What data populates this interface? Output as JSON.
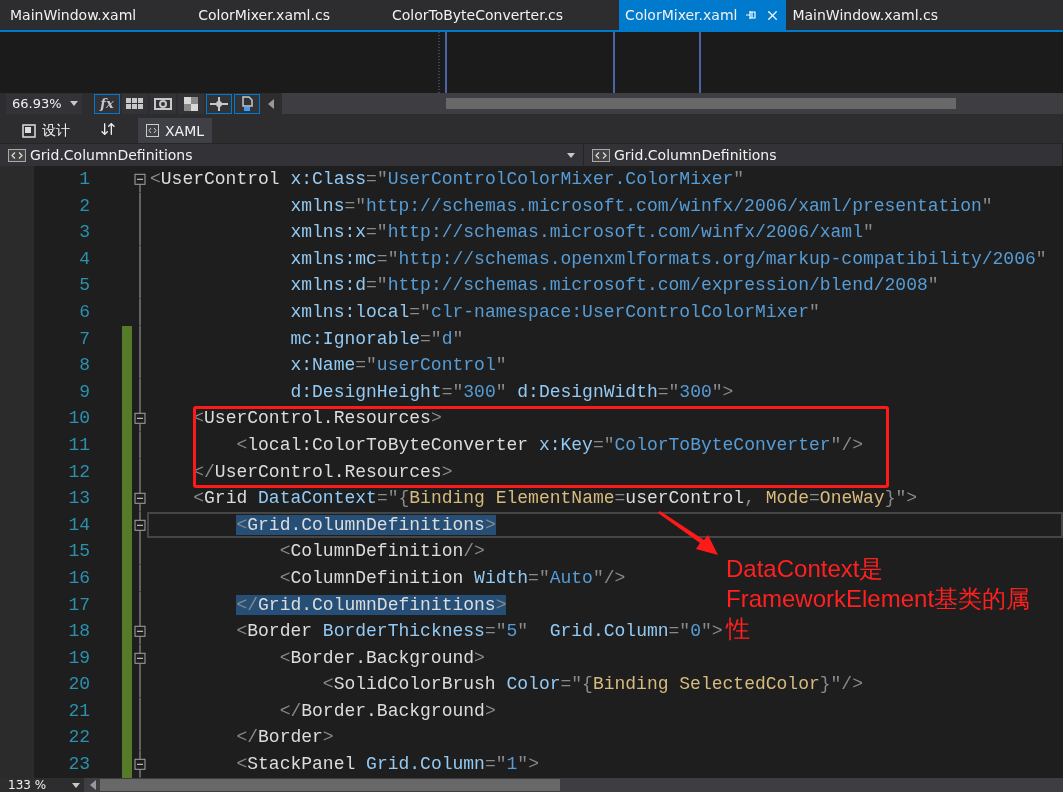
{
  "tabs": [
    {
      "label": "MainWindow.xaml",
      "selected": false
    },
    {
      "label": "ColorMixer.xaml.cs",
      "selected": false
    },
    {
      "label": "ColorToByteConverter.cs",
      "selected": false
    },
    {
      "label": "ColorMixer.xaml",
      "selected": true
    },
    {
      "label": "MainWindow.xaml.cs",
      "selected": false
    }
  ],
  "design_toolbar": {
    "zoom": "66.93%",
    "tools": [
      {
        "kind": "fx",
        "label": "fx",
        "on": true
      },
      {
        "kind": "grid",
        "on": false
      },
      {
        "kind": "snap",
        "on": false
      },
      {
        "kind": "checker",
        "on": false
      },
      {
        "kind": "crosshair",
        "on": true
      },
      {
        "kind": "refresh",
        "on": true
      }
    ]
  },
  "view_tabs": [
    {
      "kind": "design",
      "label": "设计",
      "selected": false
    },
    {
      "kind": "xaml",
      "label": "XAML",
      "selected": true
    }
  ],
  "nav_bar": {
    "left": "Grid.ColumnDefinitions",
    "right": "Grid.ColumnDefinitions"
  },
  "editor": {
    "zoom": "133 %",
    "lines": [
      {
        "number": "1",
        "modified": false,
        "collapsible": true,
        "current": false,
        "matched": false,
        "segments": [
          {
            "kind": "punct",
            "text": "<"
          },
          {
            "kind": "element",
            "text": "UserControl"
          },
          {
            "kind": "attribute",
            "text": " x:Class"
          },
          {
            "kind": "punct",
            "text": "=\""
          },
          {
            "kind": "value",
            "text": "UserControlColorMixer.ColorMixer"
          },
          {
            "kind": "punct",
            "text": "\""
          }
        ]
      },
      {
        "number": "2",
        "modified": false,
        "collapsible": false,
        "current": false,
        "matched": false,
        "segments": [
          {
            "kind": "attribute",
            "text": "             xmlns"
          },
          {
            "kind": "punct",
            "text": "=\""
          },
          {
            "kind": "value",
            "text": "http://schemas.microsoft.com/winfx/2006/xaml/presentation"
          },
          {
            "kind": "punct",
            "text": "\""
          }
        ]
      },
      {
        "number": "3",
        "modified": false,
        "collapsible": false,
        "current": false,
        "matched": false,
        "segments": [
          {
            "kind": "attribute",
            "text": "             xmlns:x"
          },
          {
            "kind": "punct",
            "text": "=\""
          },
          {
            "kind": "value",
            "text": "http://schemas.microsoft.com/winfx/2006/xaml"
          },
          {
            "kind": "punct",
            "text": "\""
          }
        ]
      },
      {
        "number": "4",
        "modified": false,
        "collapsible": false,
        "current": false,
        "matched": false,
        "segments": [
          {
            "kind": "attribute",
            "text": "             xmlns:mc"
          },
          {
            "kind": "punct",
            "text": "=\""
          },
          {
            "kind": "value",
            "text": "http://schemas.openxmlformats.org/markup-compatibility/2006"
          },
          {
            "kind": "punct",
            "text": "\""
          }
        ]
      },
      {
        "number": "5",
        "modified": false,
        "collapsible": false,
        "current": false,
        "matched": false,
        "segments": [
          {
            "kind": "attribute",
            "text": "             xmlns:d"
          },
          {
            "kind": "punct",
            "text": "=\""
          },
          {
            "kind": "value",
            "text": "http://schemas.microsoft.com/expression/blend/2008"
          },
          {
            "kind": "punct",
            "text": "\""
          }
        ]
      },
      {
        "number": "6",
        "modified": false,
        "collapsible": false,
        "current": false,
        "matched": false,
        "segments": [
          {
            "kind": "attribute",
            "text": "             xmlns:local"
          },
          {
            "kind": "punct",
            "text": "=\""
          },
          {
            "kind": "value",
            "text": "clr-namespace:UserControlColorMixer"
          },
          {
            "kind": "punct",
            "text": "\""
          }
        ]
      },
      {
        "number": "7",
        "modified": true,
        "collapsible": false,
        "current": false,
        "matched": false,
        "segments": [
          {
            "kind": "attribute",
            "text": "             mc:Ignorable"
          },
          {
            "kind": "punct",
            "text": "=\""
          },
          {
            "kind": "value",
            "text": "d"
          },
          {
            "kind": "punct",
            "text": "\""
          }
        ]
      },
      {
        "number": "8",
        "modified": true,
        "collapsible": false,
        "current": false,
        "matched": false,
        "segments": [
          {
            "kind": "attribute",
            "text": "             x:Name"
          },
          {
            "kind": "punct",
            "text": "=\""
          },
          {
            "kind": "value",
            "text": "userControl"
          },
          {
            "kind": "punct",
            "text": "\""
          }
        ]
      },
      {
        "number": "9",
        "modified": true,
        "collapsible": false,
        "current": false,
        "matched": false,
        "segments": [
          {
            "kind": "attribute",
            "text": "             d:DesignHeight"
          },
          {
            "kind": "punct",
            "text": "=\""
          },
          {
            "kind": "value",
            "text": "300"
          },
          {
            "kind": "punct",
            "text": "\""
          },
          {
            "kind": "attribute",
            "text": " d:DesignWidth"
          },
          {
            "kind": "punct",
            "text": "=\""
          },
          {
            "kind": "value",
            "text": "300"
          },
          {
            "kind": "punct",
            "text": "\">"
          }
        ]
      },
      {
        "number": "10",
        "modified": true,
        "collapsible": true,
        "current": false,
        "matched": false,
        "segments": [
          {
            "kind": "punct",
            "text": "    <"
          },
          {
            "kind": "element",
            "text": "UserControl.Resources"
          },
          {
            "kind": "punct",
            "text": ">"
          }
        ]
      },
      {
        "number": "11",
        "modified": true,
        "collapsible": false,
        "current": false,
        "matched": false,
        "segments": [
          {
            "kind": "punct",
            "text": "        <"
          },
          {
            "kind": "element",
            "text": "local:ColorToByteConverter"
          },
          {
            "kind": "attribute",
            "text": " x:Key"
          },
          {
            "kind": "punct",
            "text": "=\""
          },
          {
            "kind": "value",
            "text": "ColorToByteConverter"
          },
          {
            "kind": "punct",
            "text": "\"/>"
          }
        ]
      },
      {
        "number": "12",
        "modified": true,
        "collapsible": false,
        "current": false,
        "matched": false,
        "segments": [
          {
            "kind": "punct",
            "text": "    </"
          },
          {
            "kind": "element",
            "text": "UserControl.Resources"
          },
          {
            "kind": "punct",
            "text": ">"
          }
        ]
      },
      {
        "number": "13",
        "modified": true,
        "collapsible": true,
        "current": false,
        "matched": false,
        "segments": [
          {
            "kind": "punct",
            "text": "    <"
          },
          {
            "kind": "element",
            "text": "Grid"
          },
          {
            "kind": "attribute",
            "text": " DataContext"
          },
          {
            "kind": "punct",
            "text": "=\"{"
          },
          {
            "kind": "markup",
            "text": "Binding ElementName"
          },
          {
            "kind": "punct",
            "text": "="
          },
          {
            "kind": "element",
            "text": "userControl"
          },
          {
            "kind": "punct",
            "text": ","
          },
          {
            "kind": "markup",
            "text": " Mode"
          },
          {
            "kind": "punct",
            "text": "="
          },
          {
            "kind": "markup",
            "text": "OneWay"
          },
          {
            "kind": "punct",
            "text": "}\">"
          }
        ]
      },
      {
        "number": "14",
        "modified": true,
        "collapsible": true,
        "current": true,
        "matched": true,
        "segments": [
          {
            "kind": "punct",
            "text": "        <"
          },
          {
            "kind": "element",
            "text": "Grid.ColumnDefinitions"
          },
          {
            "kind": "punct",
            "text": ">"
          }
        ]
      },
      {
        "number": "15",
        "modified": true,
        "collapsible": false,
        "current": false,
        "matched": false,
        "segments": [
          {
            "kind": "punct",
            "text": "            <"
          },
          {
            "kind": "element",
            "text": "ColumnDefinition"
          },
          {
            "kind": "punct",
            "text": "/>"
          }
        ]
      },
      {
        "number": "16",
        "modified": true,
        "collapsible": false,
        "current": false,
        "matched": false,
        "segments": [
          {
            "kind": "punct",
            "text": "            <"
          },
          {
            "kind": "element",
            "text": "ColumnDefinition"
          },
          {
            "kind": "attribute",
            "text": " Width"
          },
          {
            "kind": "punct",
            "text": "=\""
          },
          {
            "kind": "value",
            "text": "Auto"
          },
          {
            "kind": "punct",
            "text": "\"/>"
          }
        ]
      },
      {
        "number": "17",
        "modified": true,
        "collapsible": false,
        "current": false,
        "matched": true,
        "segments": [
          {
            "kind": "punct",
            "text": "        </"
          },
          {
            "kind": "element",
            "text": "Grid.ColumnDefinitions"
          },
          {
            "kind": "punct",
            "text": ">"
          }
        ]
      },
      {
        "number": "18",
        "modified": true,
        "collapsible": true,
        "current": false,
        "matched": false,
        "segments": [
          {
            "kind": "punct",
            "text": "        <"
          },
          {
            "kind": "element",
            "text": "Border"
          },
          {
            "kind": "attribute",
            "text": " BorderThickness"
          },
          {
            "kind": "punct",
            "text": "=\""
          },
          {
            "kind": "value",
            "text": "5"
          },
          {
            "kind": "punct",
            "text": "\""
          },
          {
            "kind": "attribute",
            "text": "  Grid.Column"
          },
          {
            "kind": "punct",
            "text": "=\""
          },
          {
            "kind": "value",
            "text": "0"
          },
          {
            "kind": "punct",
            "text": "\">"
          }
        ]
      },
      {
        "number": "19",
        "modified": true,
        "collapsible": true,
        "current": false,
        "matched": false,
        "segments": [
          {
            "kind": "punct",
            "text": "            <"
          },
          {
            "kind": "element",
            "text": "Border.Background"
          },
          {
            "kind": "punct",
            "text": ">"
          }
        ]
      },
      {
        "number": "20",
        "modified": true,
        "collapsible": false,
        "current": false,
        "matched": false,
        "segments": [
          {
            "kind": "punct",
            "text": "                <"
          },
          {
            "kind": "element",
            "text": "SolidColorBrush"
          },
          {
            "kind": "attribute",
            "text": " Color"
          },
          {
            "kind": "punct",
            "text": "=\"{"
          },
          {
            "kind": "markup",
            "text": "Binding SelectedColor"
          },
          {
            "kind": "punct",
            "text": "}\"/>"
          }
        ]
      },
      {
        "number": "21",
        "modified": true,
        "collapsible": false,
        "current": false,
        "matched": false,
        "segments": [
          {
            "kind": "punct",
            "text": "            </"
          },
          {
            "kind": "element",
            "text": "Border.Background"
          },
          {
            "kind": "punct",
            "text": ">"
          }
        ]
      },
      {
        "number": "22",
        "modified": true,
        "collapsible": false,
        "current": false,
        "matched": false,
        "segments": [
          {
            "kind": "punct",
            "text": "        </"
          },
          {
            "kind": "element",
            "text": "Border"
          },
          {
            "kind": "punct",
            "text": ">"
          }
        ]
      },
      {
        "number": "23",
        "modified": true,
        "collapsible": true,
        "current": false,
        "matched": false,
        "segments": [
          {
            "kind": "punct",
            "text": "        <"
          },
          {
            "kind": "element",
            "text": "StackPanel"
          },
          {
            "kind": "attribute",
            "text": " Grid.Column"
          },
          {
            "kind": "punct",
            "text": "=\""
          },
          {
            "kind": "value",
            "text": "1"
          },
          {
            "kind": "punct",
            "text": "\">"
          }
        ]
      }
    ]
  },
  "annotation": {
    "text": "DataContext是FrameworkElement基类的属性"
  }
}
